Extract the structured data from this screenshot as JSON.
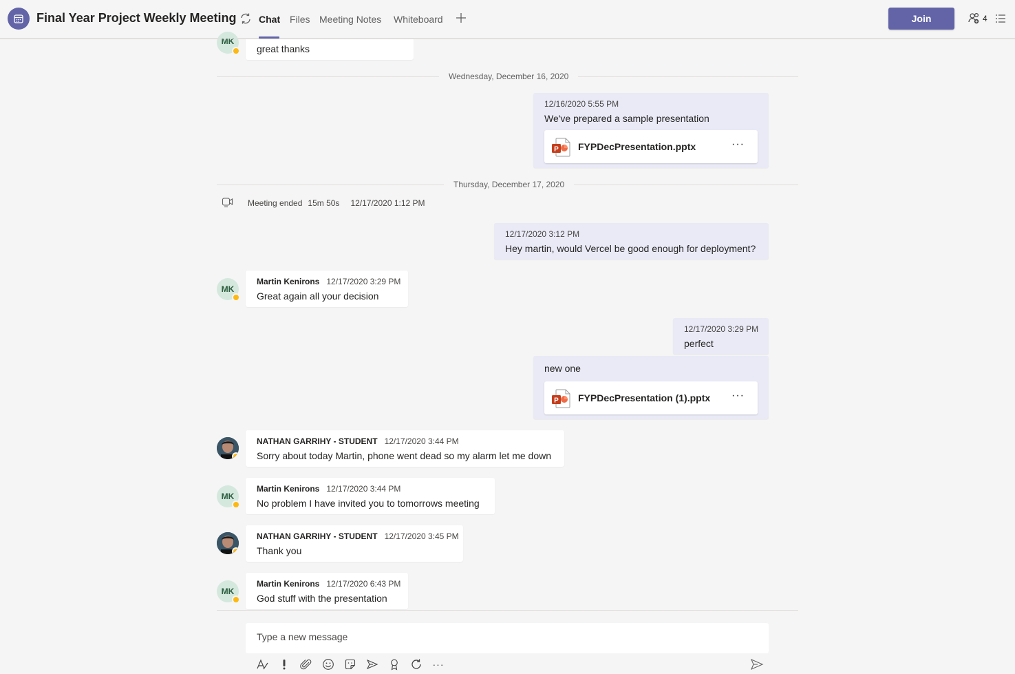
{
  "header": {
    "title": "Final Year Project Weekly Meeting",
    "tabs": [
      {
        "label": "Chat",
        "active": true
      },
      {
        "label": "Files",
        "active": false
      },
      {
        "label": "Meeting Notes",
        "active": false
      },
      {
        "label": "Whiteboard",
        "active": false
      }
    ],
    "join_label": "Join",
    "participant_count": "4",
    "accent_color": "#6264a7"
  },
  "messages": {
    "m0": {
      "initials": "MK",
      "text": "great thanks"
    },
    "date1": "Wednesday, December 16, 2020",
    "m1": {
      "time": "12/16/2020 5:55 PM",
      "text": "We've prepared a sample presentation",
      "file": "FYPDecPresentation.pptx"
    },
    "date2": "Thursday, December 17, 2020",
    "sys": {
      "label": "Meeting ended",
      "duration": "15m 50s",
      "time": "12/17/2020 1:12 PM"
    },
    "m2": {
      "time": "12/17/2020 3:12 PM",
      "text": "Hey martin, would Vercel be good enough for deployment?"
    },
    "m3": {
      "initials": "MK",
      "author": "Martin Kenirons",
      "time": "12/17/2020 3:29 PM",
      "text": "Great again all your decision"
    },
    "m4": {
      "time": "12/17/2020 3:29 PM",
      "text": "perfect"
    },
    "m5": {
      "text": "new one",
      "file": "FYPDecPresentation (1).pptx"
    },
    "m6": {
      "author": "NATHAN GARRIHY - STUDENT",
      "time": "12/17/2020 3:44 PM",
      "text": "Sorry about today Martin, phone went dead so my alarm let me down"
    },
    "m7": {
      "initials": "MK",
      "author": "Martin Kenirons",
      "time": "12/17/2020 3:44 PM",
      "text": "No problem I have invited you to tomorrows meeting"
    },
    "m8": {
      "author": "NATHAN GARRIHY - STUDENT",
      "time": "12/17/2020 3:45 PM",
      "text": "Thank you"
    },
    "m9": {
      "initials": "MK",
      "author": "Martin Kenirons",
      "time": "12/17/2020 6:43 PM",
      "text": "God stuff with the presentation"
    }
  },
  "compose": {
    "placeholder": "Type a new message",
    "tools": [
      "format-icon",
      "important-icon",
      "attach-icon",
      "emoji-icon",
      "sticker-icon",
      "schedule-meeting-icon",
      "praise-icon",
      "loop-icon",
      "more-options-icon",
      "send-icon"
    ]
  }
}
